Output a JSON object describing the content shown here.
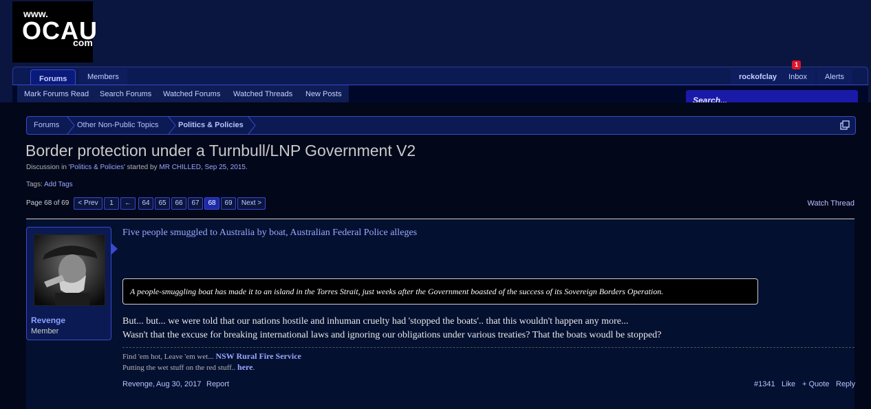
{
  "logo": {
    "www": "www.",
    "main": "OCAU",
    "com": "com"
  },
  "nav": {
    "forums": "Forums",
    "members": "Members",
    "user": "rockofclay",
    "inbox": "Inbox",
    "inbox_badge": "1",
    "alerts": "Alerts"
  },
  "subnav": {
    "items": [
      "Mark Forums Read",
      "Search Forums",
      "Watched Forums",
      "Watched Threads",
      "New Posts"
    ]
  },
  "search": {
    "placeholder": "Search..."
  },
  "breadcrumb": [
    "Forums",
    "Other Non-Public Topics",
    "Politics & Policies"
  ],
  "thread": {
    "title": "Border protection under a Turnbull/LNP Government V2",
    "meta_prefix": "Discussion in '",
    "meta_forum": "Politics & Policies",
    "meta_mid": "' started by ",
    "meta_author": "MR CHILLED",
    "meta_sep": ", ",
    "meta_date": "Sep 25, 2015",
    "meta_end": ".",
    "tags_label": "Tags:",
    "tags_add": "Add Tags"
  },
  "pagination": {
    "label": "Page 68 of 69",
    "prev": "< Prev",
    "first": "1",
    "skip": "←",
    "pages": [
      "64",
      "65",
      "66",
      "67",
      "68",
      "69"
    ],
    "current": "68",
    "next": "Next >"
  },
  "watch": "Watch Thread",
  "post": {
    "username": "Revenge",
    "user_title": "Member",
    "link_text": "Five people smuggled to Australia by boat, Australian Federal Police alleges",
    "quote": "A people-smuggling boat has made it to an island in the Torres Strait, just weeks after the Government boasted of the success of its Sovereign Borders Operation.",
    "body_1": "But... but... we were told that our nations hostile and inhuman cruelty had 'stopped the boats'.. that this wouldn't happen any more...",
    "body_2": "Wasn't that the excuse for breaking international laws and ignoring our obligations under various treaties? That the boats woudl be stopped?",
    "sig_1_text": "Find 'em hot, Leave 'em wet... ",
    "sig_1_link": "NSW Rural Fire Service",
    "sig_2_text": "Putting the wet stuff on the red stuff.. ",
    "sig_2_link": "here",
    "sig_2_end": ".",
    "footer_author": "Revenge",
    "footer_date": "Aug 30, 2017",
    "report": "Report",
    "post_num": "#1341",
    "like": "Like",
    "quote_btn": "+ Quote",
    "reply": "Reply"
  },
  "colors": {
    "background": "#0b1640",
    "link": "#9aa9ff",
    "badge": "#e0142a",
    "accent": "#3a4ad0"
  }
}
